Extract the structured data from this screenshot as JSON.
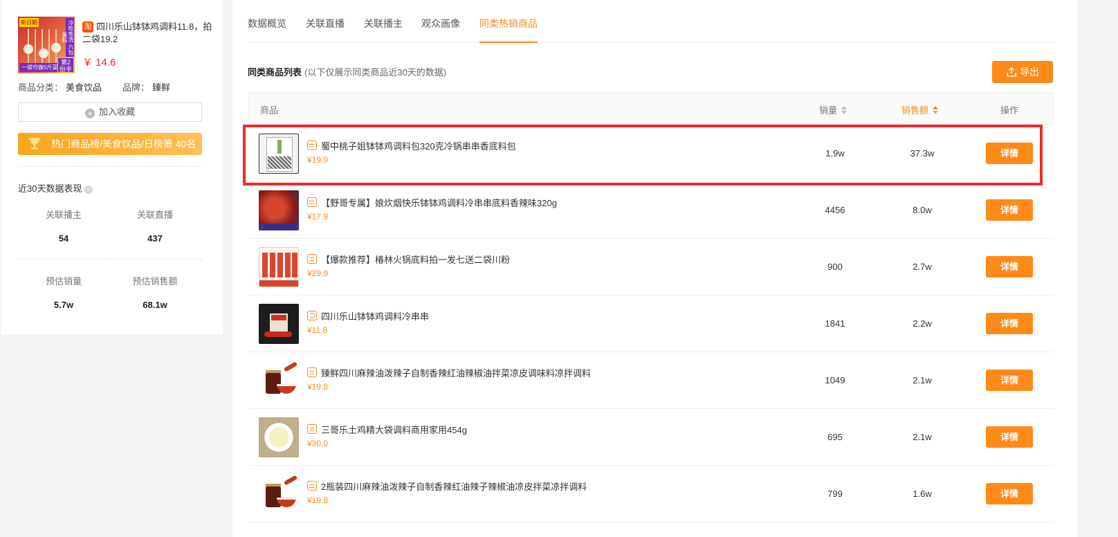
{
  "product": {
    "thumb_tags": [
      "新日期",
      "冷吃免洗 六包装料",
      "一袋可做5斤菜",
      "第2份半价"
    ],
    "platform_badge": "淘",
    "name": "四川乐山钵钵鸡调料11.8，拍二袋19.2",
    "price": "￥ 14.6",
    "category_label": "商品分类：",
    "category": "美食饮品",
    "brand_label": "品牌：",
    "brand": "臻鲜",
    "favorite_label": "加入收藏",
    "rank_text": "热门商品榜/美食饮品/日榜第 40名"
  },
  "performance": {
    "title": "近30天数据表现",
    "stats": [
      {
        "label": "关联播主",
        "value": "54"
      },
      {
        "label": "关联直播",
        "value": "437"
      },
      {
        "label": "预估销量",
        "value": "5.7w"
      },
      {
        "label": "预估销售额",
        "value": "68.1w"
      }
    ]
  },
  "tabs": [
    {
      "label": "数据概览",
      "active": false
    },
    {
      "label": "关联直播",
      "active": false
    },
    {
      "label": "关联播主",
      "active": false
    },
    {
      "label": "观众画像",
      "active": false
    },
    {
      "label": "同类热销商品",
      "active": true
    }
  ],
  "list": {
    "title": "同类商品列表",
    "subtitle": "(以下仅展示同类商品近30天的数据)",
    "export_label": "导出",
    "columns": {
      "product": "商品",
      "sales": "销量",
      "amount": "销售额",
      "action": "操作"
    },
    "detail_label": "详情",
    "rows": [
      {
        "title": "蜀中桃子姐钵钵鸡调料包320克冷锅串串香底料包",
        "price": "¥19.9",
        "sales": "1.9w",
        "amount": "37.3w"
      },
      {
        "title": "【野哥专属】娘炊烟快乐钵钵鸡调料冷串串底料香辣味320g",
        "price": "¥17.9",
        "sales": "4456",
        "amount": "8.0w"
      },
      {
        "title": "【爆款推荐】椿林火锅底料拍一发七送二袋川粉",
        "price": "¥29.9",
        "sales": "900",
        "amount": "2.7w"
      },
      {
        "title": "四川乐山钵钵鸡调料冷串串",
        "price": "¥11.8",
        "sales": "1841",
        "amount": "2.2w"
      },
      {
        "title": "臻鲜四川麻辣油泼辣子自制香辣红油辣椒油拌菜凉皮调味料凉拌调料",
        "price": "¥19.8",
        "sales": "1049",
        "amount": "2.1w"
      },
      {
        "title": "三哥乐土鸡精大袋调料商用家用454g",
        "price": "¥30.0",
        "sales": "695",
        "amount": "2.1w"
      },
      {
        "title": "2瓶装四川麻辣油泼辣子自制香辣红油辣子辣椒油凉皮拌菜凉拌调料",
        "price": "¥19.8",
        "sales": "799",
        "amount": "1.6w"
      }
    ]
  },
  "colors": {
    "accent": "#ff8a1a",
    "price_red": "#f5222d",
    "highlight": "#ee2b2b"
  }
}
